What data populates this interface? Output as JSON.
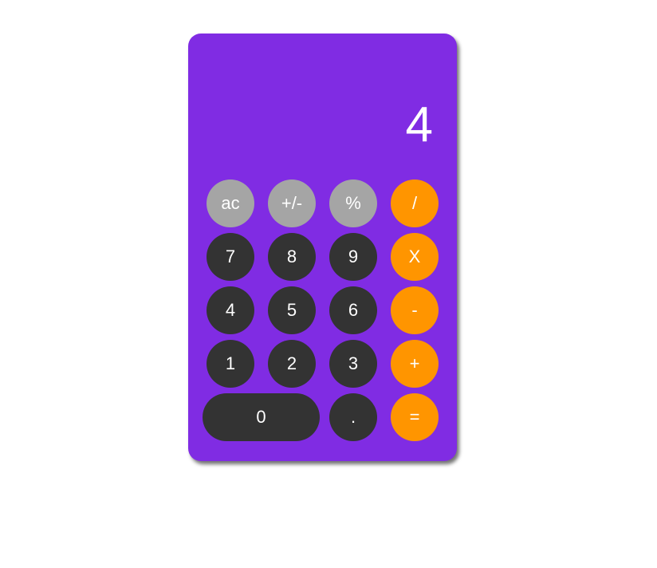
{
  "display": {
    "value": "4"
  },
  "colors": {
    "body": "#802ce3",
    "function_key": "#a5a5a5",
    "number_key": "#333333",
    "operator_key": "#ff9500",
    "text": "#ffffff"
  },
  "keys": {
    "ac": "ac",
    "sign": "+/-",
    "percent": "%",
    "divide": "/",
    "seven": "7",
    "eight": "8",
    "nine": "9",
    "multiply": "X",
    "four": "4",
    "five": "5",
    "six": "6",
    "subtract": "-",
    "one": "1",
    "two": "2",
    "three": "3",
    "add": "+",
    "zero": "0",
    "decimal": ".",
    "equals": "="
  }
}
